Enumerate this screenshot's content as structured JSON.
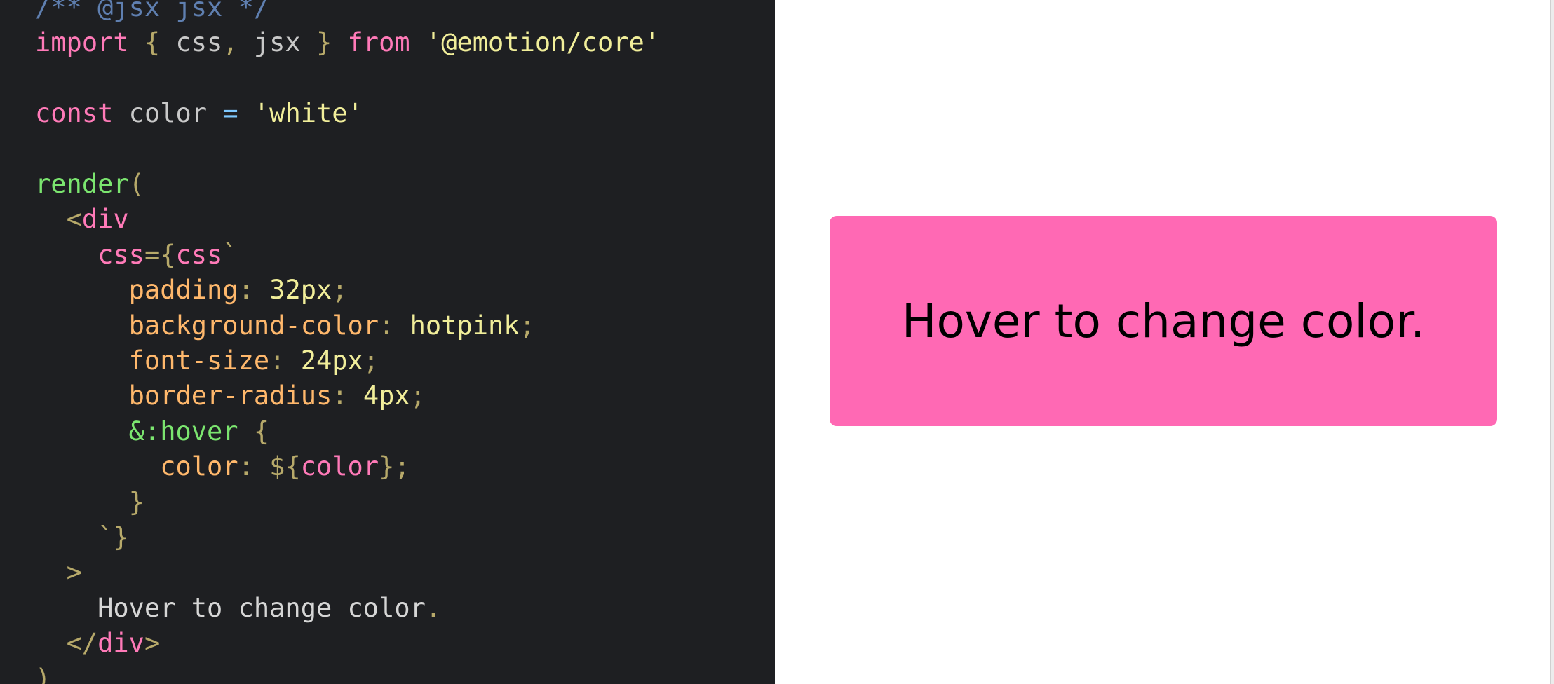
{
  "editor": {
    "lines": [
      [
        {
          "t": "/** @jsx jsx */",
          "c": "comment"
        }
      ],
      [
        {
          "t": "import",
          "c": "keyword"
        },
        {
          "t": " { ",
          "c": "punct"
        },
        {
          "t": "css",
          "c": "ident"
        },
        {
          "t": ", ",
          "c": "punct"
        },
        {
          "t": "jsx",
          "c": "ident"
        },
        {
          "t": " } ",
          "c": "punct"
        },
        {
          "t": "from",
          "c": "keyword"
        },
        {
          "t": " ",
          "c": "text"
        },
        {
          "t": "'@emotion/core'",
          "c": "string"
        }
      ],
      [],
      [
        {
          "t": "const",
          "c": "keyword"
        },
        {
          "t": " color ",
          "c": "ident"
        },
        {
          "t": "=",
          "c": "op"
        },
        {
          "t": " ",
          "c": "text"
        },
        {
          "t": "'white'",
          "c": "string"
        }
      ],
      [],
      [
        {
          "t": "render",
          "c": "fn"
        },
        {
          "t": "(",
          "c": "punct"
        }
      ],
      [
        {
          "t": "  ",
          "c": "text"
        },
        {
          "t": "<",
          "c": "punct"
        },
        {
          "t": "div",
          "c": "tag"
        }
      ],
      [
        {
          "t": "    ",
          "c": "text"
        },
        {
          "t": "css",
          "c": "keyword"
        },
        {
          "t": "={",
          "c": "punct"
        },
        {
          "t": "css",
          "c": "keyword"
        },
        {
          "t": "`",
          "c": "punct"
        }
      ],
      [
        {
          "t": "      ",
          "c": "text"
        },
        {
          "t": "padding",
          "c": "prop"
        },
        {
          "t": ": ",
          "c": "punct"
        },
        {
          "t": "32px",
          "c": "string"
        },
        {
          "t": ";",
          "c": "punct"
        }
      ],
      [
        {
          "t": "      ",
          "c": "text"
        },
        {
          "t": "background-color",
          "c": "prop"
        },
        {
          "t": ": ",
          "c": "punct"
        },
        {
          "t": "hotpink",
          "c": "string"
        },
        {
          "t": ";",
          "c": "punct"
        }
      ],
      [
        {
          "t": "      ",
          "c": "text"
        },
        {
          "t": "font-size",
          "c": "prop"
        },
        {
          "t": ": ",
          "c": "punct"
        },
        {
          "t": "24px",
          "c": "string"
        },
        {
          "t": ";",
          "c": "punct"
        }
      ],
      [
        {
          "t": "      ",
          "c": "text"
        },
        {
          "t": "border-radius",
          "c": "prop"
        },
        {
          "t": ": ",
          "c": "punct"
        },
        {
          "t": "4px",
          "c": "string"
        },
        {
          "t": ";",
          "c": "punct"
        }
      ],
      [
        {
          "t": "      ",
          "c": "text"
        },
        {
          "t": "&:hover",
          "c": "fn"
        },
        {
          "t": " {",
          "c": "punct"
        }
      ],
      [
        {
          "t": "        ",
          "c": "text"
        },
        {
          "t": "color",
          "c": "prop"
        },
        {
          "t": ": ",
          "c": "punct"
        },
        {
          "t": "${",
          "c": "punct"
        },
        {
          "t": "color",
          "c": "keyword"
        },
        {
          "t": "}",
          "c": "punct"
        },
        {
          "t": ";",
          "c": "punct"
        }
      ],
      [
        {
          "t": "      ",
          "c": "text"
        },
        {
          "t": "}",
          "c": "punct"
        }
      ],
      [
        {
          "t": "    ",
          "c": "text"
        },
        {
          "t": "`}",
          "c": "punct"
        }
      ],
      [
        {
          "t": "  ",
          "c": "text"
        },
        {
          "t": ">",
          "c": "punct"
        }
      ],
      [
        {
          "t": "    ",
          "c": "text"
        },
        {
          "t": "Hover to change color",
          "c": "text"
        },
        {
          "t": ".",
          "c": "punct"
        }
      ],
      [
        {
          "t": "  ",
          "c": "text"
        },
        {
          "t": "</",
          "c": "punct"
        },
        {
          "t": "div",
          "c": "tag"
        },
        {
          "t": ">",
          "c": "punct"
        }
      ],
      [
        {
          "t": ")",
          "c": "punct"
        }
      ]
    ]
  },
  "preview": {
    "demo_text": "Hover to change color.",
    "background_color": "#ff69b4",
    "hover_text_color": "#ffffff"
  },
  "colors": {
    "editor_background": "#1e1f22",
    "keyword": "#ff7ab8",
    "string": "#f1ee9a",
    "function": "#7be56f",
    "property": "#ffb86c",
    "punctuation": "#b7a96a",
    "identifier": "#c9c9c9",
    "operator": "#7ec8ff",
    "comment": "#5f7fb0"
  }
}
